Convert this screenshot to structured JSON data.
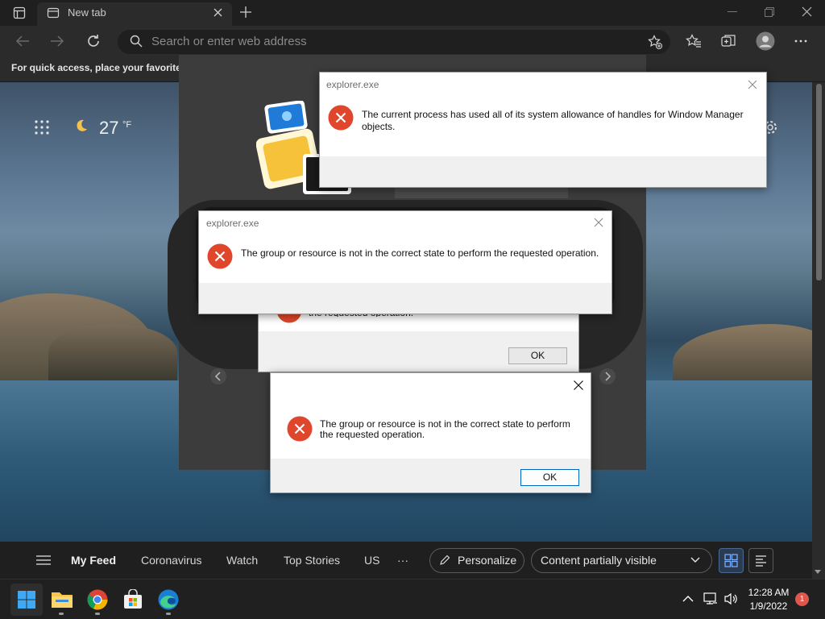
{
  "browser": {
    "tab_title": "New tab",
    "address_placeholder": "Search or enter web address",
    "favorites_bar_text": "For quick access, place your favorites h"
  },
  "new_tab_page": {
    "weather_temp": "27",
    "weather_unit": "°F"
  },
  "news_bar": {
    "items": [
      "My Feed",
      "Coronavirus",
      "Watch",
      "Top Stories",
      "US"
    ],
    "more": "···",
    "personalize_label": "Personalize",
    "content_select_label": "Content partially visible"
  },
  "dialogs": [
    {
      "title": "explorer.exe",
      "message": "The current process has used all of its system allowance of handles for Window Manager objects."
    },
    {
      "title": "explorer.exe",
      "message": "The group or resource is not in the correct state to perform the requested operation."
    },
    {
      "partial_message": "the requested operation.",
      "ok_label": "OK"
    },
    {
      "message_line1": "The group or resource is not in the correct state to perform",
      "message_line2": "the requested operation.",
      "ok_label": "OK"
    }
  ],
  "taskbar": {
    "time": "12:28 AM",
    "date": "1/9/2022",
    "notification_count": "1",
    "apps": [
      "start-icon",
      "file-explorer-icon",
      "chrome-icon",
      "store-icon",
      "edge-icon"
    ]
  },
  "colors": {
    "error_red": "#e0462b",
    "accent_blue": "#0067c0"
  }
}
